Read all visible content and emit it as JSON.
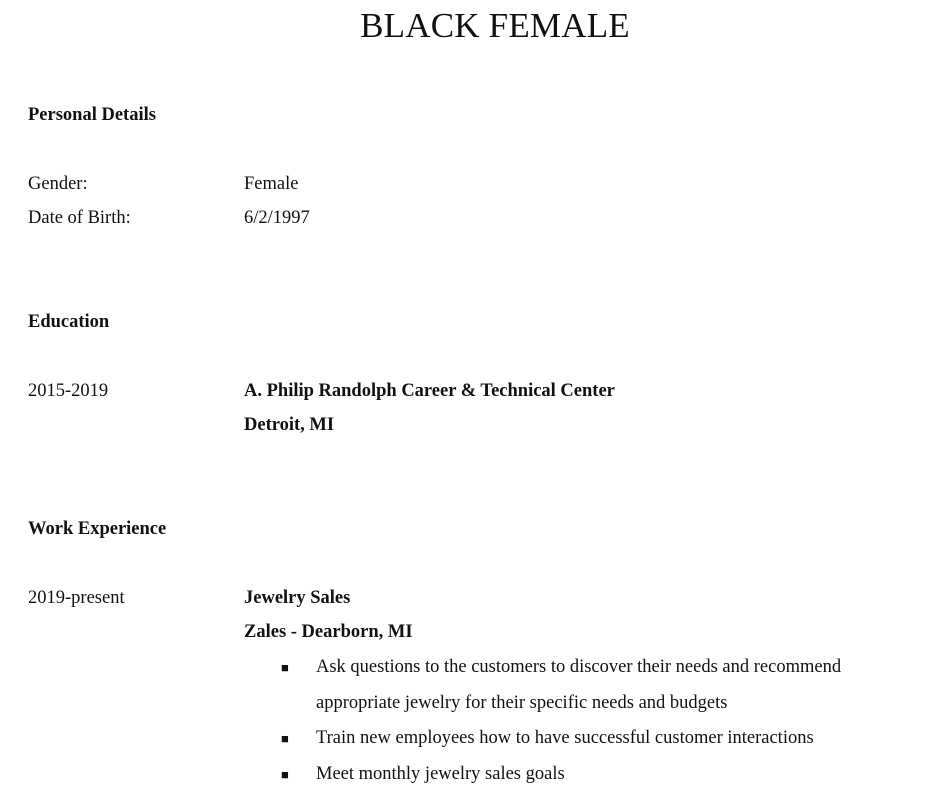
{
  "title": "BLACK FEMALE",
  "personal": {
    "heading": "Personal Details",
    "rows": [
      {
        "label": "Gender:",
        "value": "Female"
      },
      {
        "label": "Date of Birth:",
        "value": "6/2/1997"
      }
    ]
  },
  "education": {
    "heading": "Education",
    "period": "2015-2019",
    "school": "A. Philip Randolph Career & Technical Center",
    "location": "Detroit, MI"
  },
  "work": {
    "heading": "Work Experience",
    "period": "2019-present",
    "role": "Jewelry Sales",
    "employer": "Zales - Dearborn, MI",
    "bullet_marker": "■",
    "bullets": [
      "Ask questions to the customers to discover their needs and recommend appropriate jewelry for their specific needs and budgets",
      "Train new employees how to have successful customer interactions",
      "Meet monthly jewelry sales goals"
    ]
  }
}
